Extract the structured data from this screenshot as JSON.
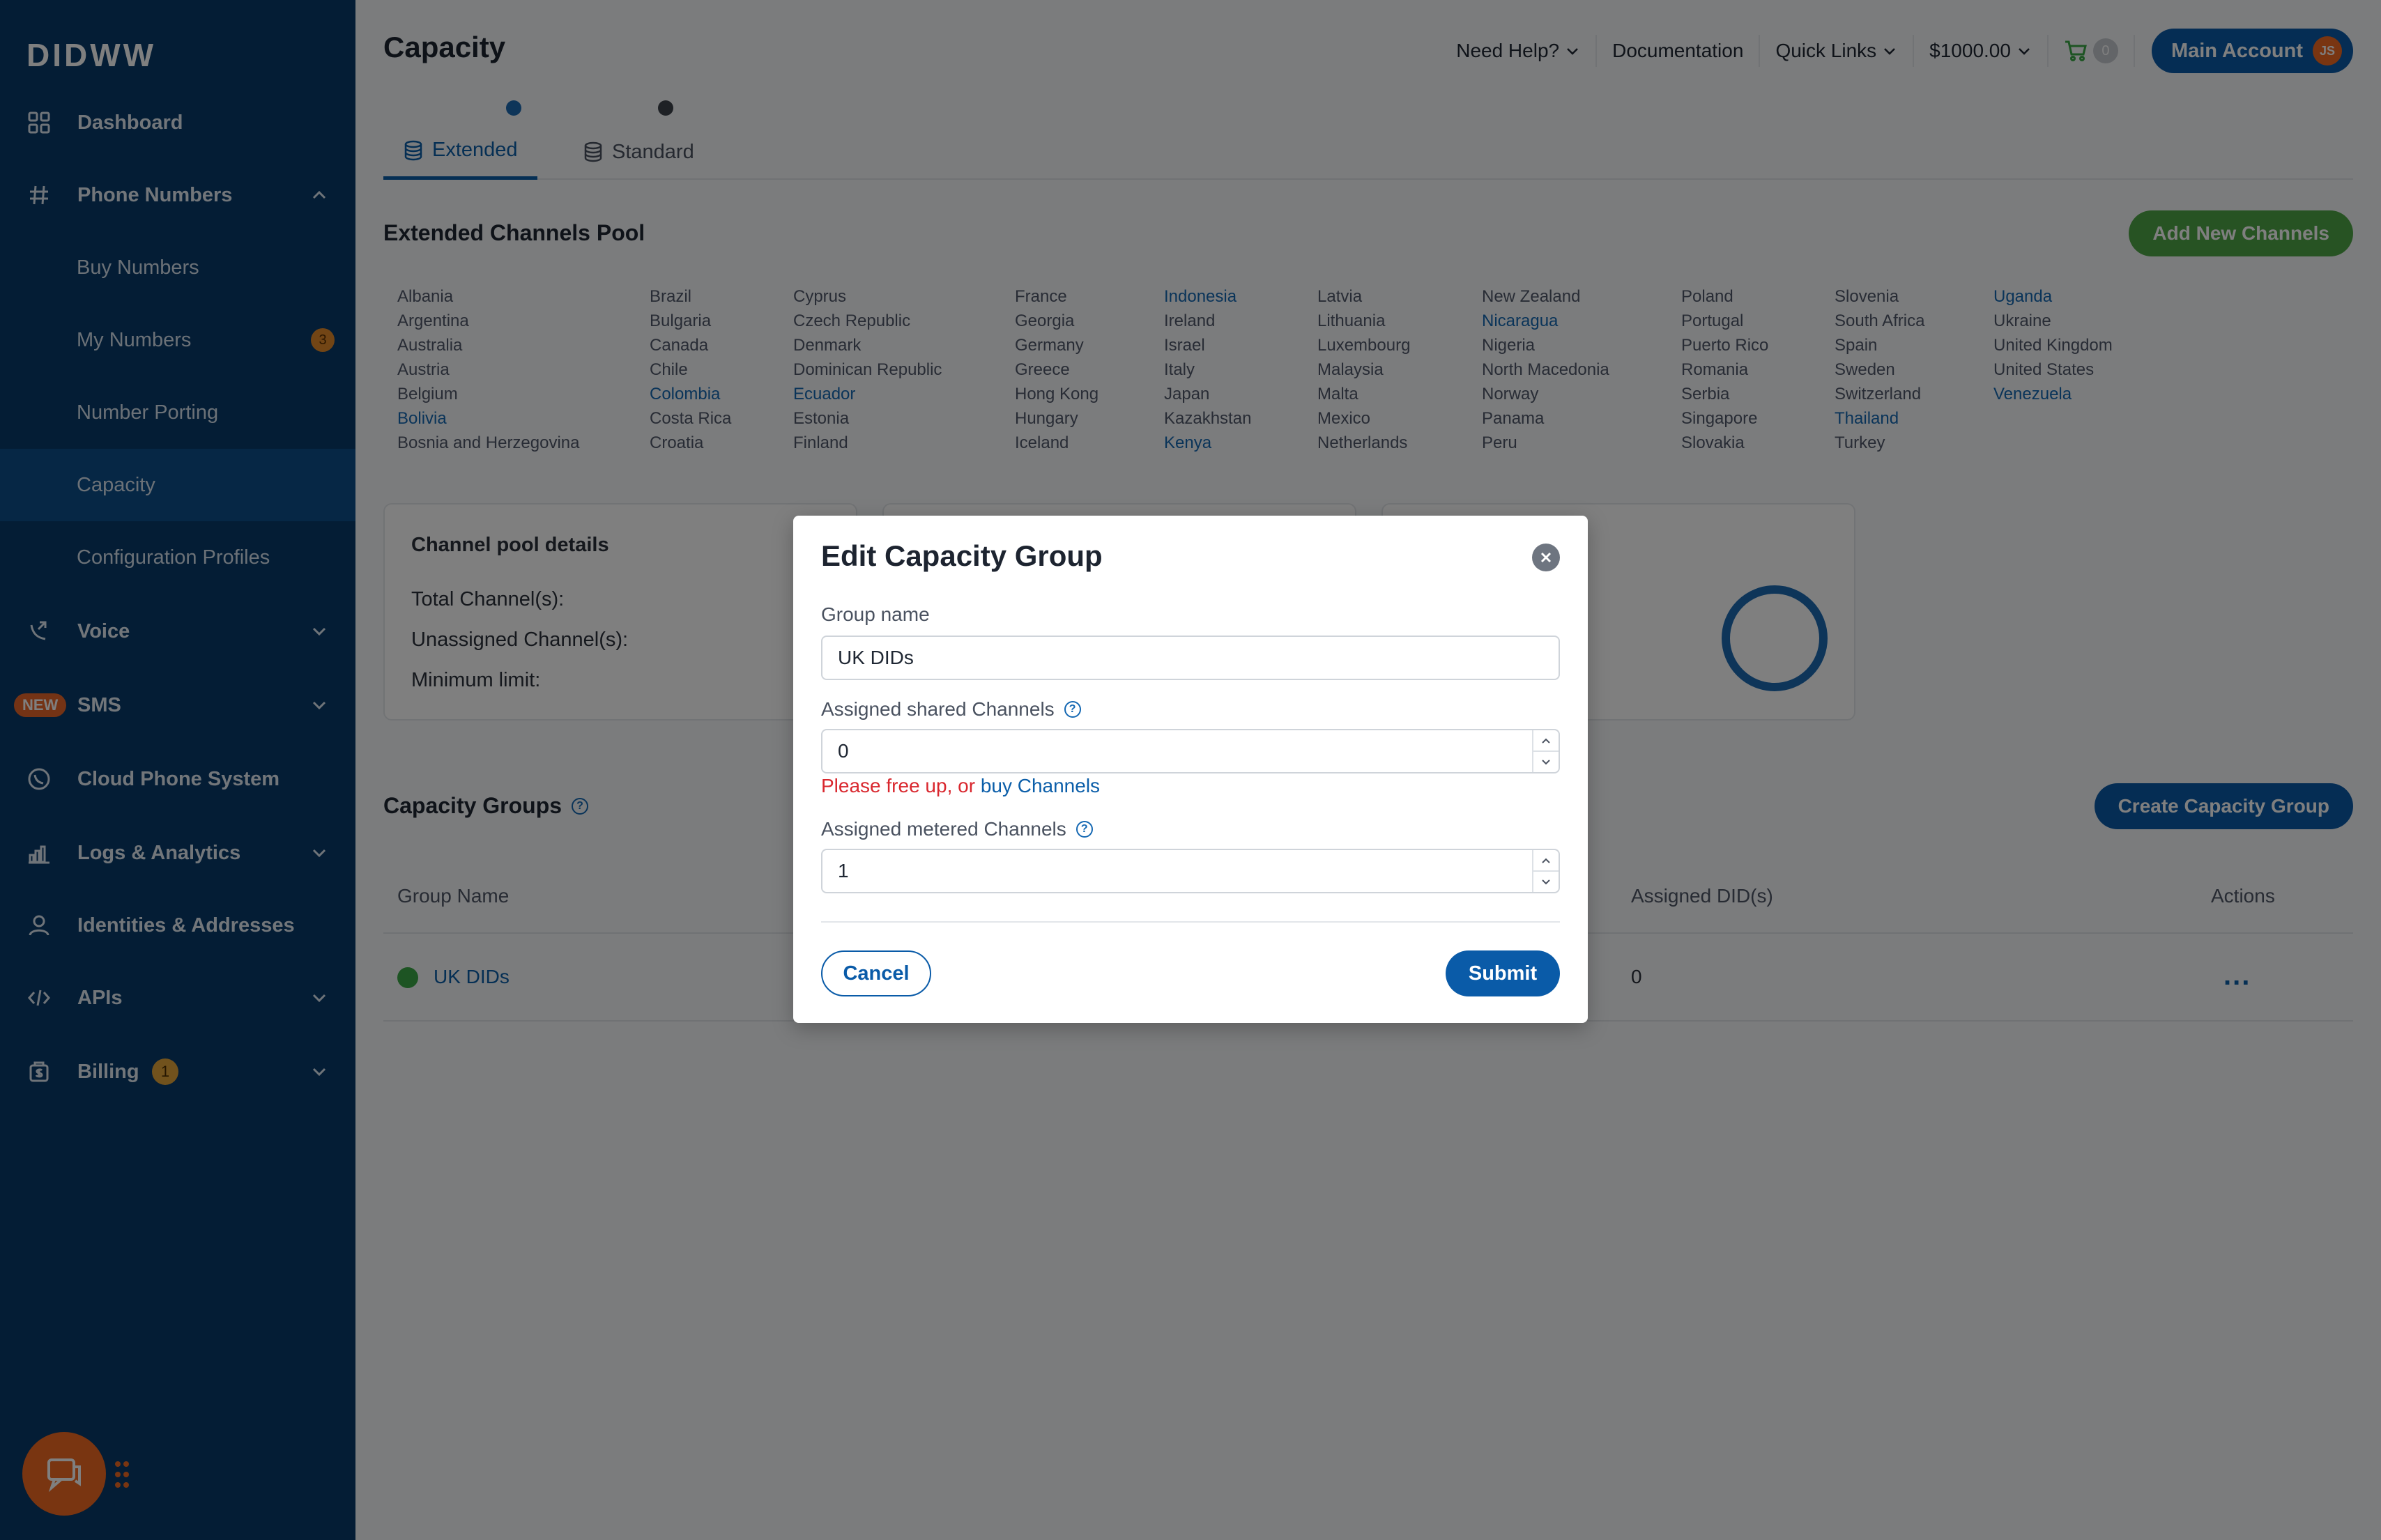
{
  "brand": {
    "logo": "DIDWW"
  },
  "sidebar": {
    "items": [
      {
        "label": "Dashboard",
        "icon": "dashboard-grid-icon"
      },
      {
        "label": "Phone Numbers",
        "icon": "hash-icon",
        "expanded": true
      },
      {
        "label": "Buy Numbers",
        "sub": true
      },
      {
        "label": "My Numbers",
        "sub": true,
        "count": "3"
      },
      {
        "label": "Number Porting",
        "sub": true
      },
      {
        "label": "Capacity",
        "sub": true,
        "active": true
      },
      {
        "label": "Configuration Profiles",
        "sub": true
      },
      {
        "label": "Voice",
        "icon": "voice-icon"
      },
      {
        "label": "SMS",
        "badge": "NEW"
      },
      {
        "label": "Cloud Phone System",
        "icon": "phone-icon"
      },
      {
        "label": "Logs & Analytics",
        "icon": "bar-chart-icon"
      },
      {
        "label": "Identities & Addresses",
        "icon": "user-icon"
      },
      {
        "label": "APIs",
        "icon": "code-icon"
      },
      {
        "label": "Billing",
        "icon": "billing-icon",
        "count": "1"
      }
    ]
  },
  "header": {
    "title": "Capacity",
    "need_help": "Need Help?",
    "documentation": "Documentation",
    "quick_links": "Quick Links",
    "balance": "$1000.00",
    "cart_count": "0",
    "account": "Main Account",
    "avatar_initials": "JS"
  },
  "tabs": [
    {
      "label": "Extended",
      "active": true
    },
    {
      "label": "Standard",
      "active": false
    }
  ],
  "pool": {
    "title": "Extended Channels Pool",
    "add_button": "Add New Channels",
    "country_columns": [
      [
        "Albania",
        "Argentina",
        "Australia",
        "Austria",
        "Belgium",
        "Bolivia",
        "Bosnia and Herzegovina"
      ],
      [
        "Brazil",
        "Bulgaria",
        "Canada",
        "Chile",
        "Colombia",
        "Costa Rica",
        "Croatia"
      ],
      [
        "Cyprus",
        "Czech Republic",
        "Denmark",
        "Dominican Republic",
        "Ecuador",
        "Estonia",
        "Finland"
      ],
      [
        "France",
        "Georgia",
        "Germany",
        "Greece",
        "Hong Kong",
        "Hungary",
        "Iceland"
      ],
      [
        "Indonesia",
        "Ireland",
        "Israel",
        "Italy",
        "Japan",
        "Kazakhstan",
        "Kenya"
      ],
      [
        "Latvia",
        "Lithuania",
        "Luxembourg",
        "Malaysia",
        "Malta",
        "Mexico",
        "Netherlands"
      ],
      [
        "New Zealand",
        "Nicaragua",
        "Nigeria",
        "North Macedonia",
        "Norway",
        "Panama",
        "Peru"
      ],
      [
        "Poland",
        "Portugal",
        "Puerto Rico",
        "Romania",
        "Serbia",
        "Singapore",
        "Slovakia"
      ],
      [
        "Slovenia",
        "South Africa",
        "Spain",
        "Sweden",
        "Switzerland",
        "Thailand",
        "Turkey"
      ],
      [
        "Uganda",
        "Ukraine",
        "United Kingdom",
        "United States",
        "Venezuela"
      ]
    ],
    "linked_countries": [
      "Bolivia",
      "Colombia",
      "Ecuador",
      "Indonesia",
      "Kenya",
      "Nicaragua",
      "Thailand",
      "Uganda",
      "Venezuela"
    ]
  },
  "details_card": {
    "title": "Channel pool details",
    "total": "Total Channel(s):",
    "unassigned": "Unassigned Channel(s):",
    "minimum": "Minimum limit:"
  },
  "groups": {
    "title": "Capacity Groups",
    "create_button": "Create Capacity Group",
    "columns": {
      "name": "Group Name",
      "dids": "Assigned DID(s)",
      "actions": "Actions"
    },
    "rows": [
      {
        "name": "UK DIDs",
        "dids": "0",
        "actions": "..."
      }
    ]
  },
  "modal": {
    "title": "Edit Capacity Group",
    "group_name_label": "Group name",
    "group_name_value": "UK DIDs",
    "shared_label": "Assigned shared Channels",
    "shared_value": "0",
    "error_prefix": "Please free up, or",
    "error_link": "buy Channels",
    "metered_label": "Assigned metered Channels",
    "metered_value": "1",
    "cancel": "Cancel",
    "submit": "Submit"
  },
  "colors": {
    "sidebar": "#083a6b",
    "primary": "#0a5ba8",
    "success": "#4fa646",
    "error": "#d9272e",
    "accent": "#f36a22"
  }
}
